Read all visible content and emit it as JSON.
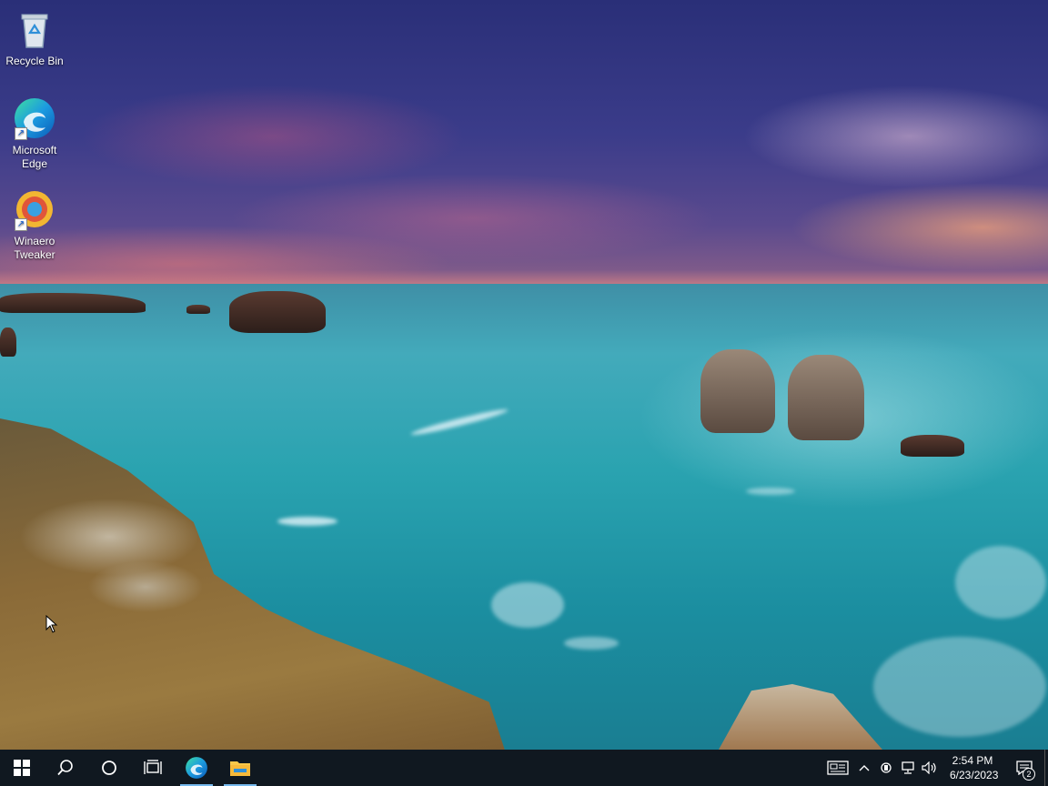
{
  "desktop": {
    "icons": [
      {
        "label": "Recycle Bin",
        "icon": "recycle-bin-icon"
      },
      {
        "label": "Microsoft\nEdge",
        "icon": "edge-icon"
      },
      {
        "label": "Winaero\nTweaker",
        "icon": "winaero-tweaker-icon"
      }
    ]
  },
  "taskbar": {
    "start": "windows-start-icon",
    "search": "search-icon",
    "cortana": "cortana-icon",
    "task_view": "task-view-icon",
    "pinned": [
      "edge-icon",
      "file-explorer-icon"
    ],
    "tray": {
      "icons": [
        "news-widget-icon",
        "chevron-up-icon",
        "meet-now-icon",
        "network-icon",
        "volume-icon"
      ],
      "time": "2:54 PM",
      "date": "6/23/2023",
      "notification_count": "2"
    }
  },
  "colors": {
    "taskbar_bg": "#101820",
    "accent": "#76b9ed"
  }
}
